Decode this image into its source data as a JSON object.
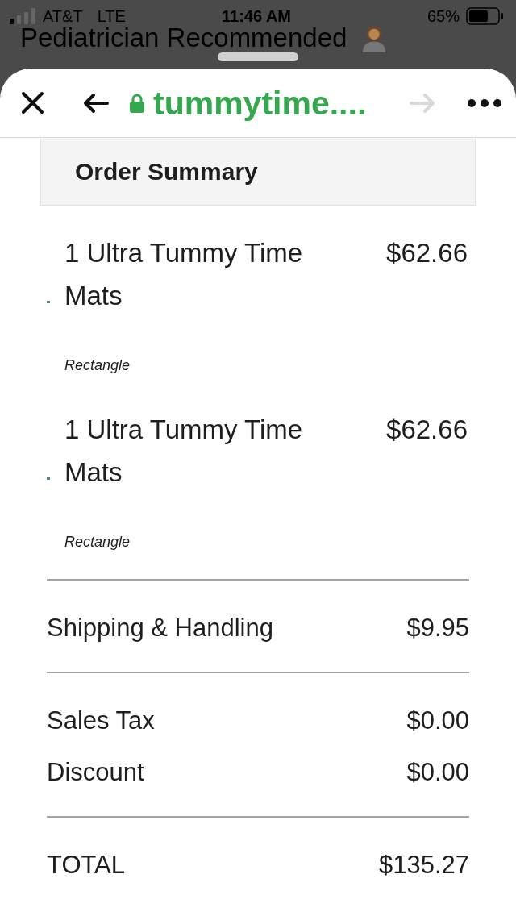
{
  "status_bar": {
    "carrier": "AT&T",
    "network": "LTE",
    "time": "11:46 AM",
    "battery": "65%"
  },
  "background_page": {
    "heading": "Pediatrician Recommended"
  },
  "browser_toolbar": {
    "url": "tummytime....",
    "secure": true,
    "forward_disabled": true
  },
  "order_summary": {
    "title": "Order Summary",
    "items": [
      {
        "name": "1 Ultra Tummy Time Mats",
        "price": "$62.66",
        "variant": "Rectangle"
      },
      {
        "name": "1 Ultra Tummy Time Mats",
        "price": "$62.66",
        "variant": "Rectangle"
      }
    ],
    "charge_groups": [
      {
        "rows": [
          {
            "label": "Shipping & Handling",
            "amount": "$9.95"
          }
        ]
      },
      {
        "rows": [
          {
            "label": "Sales Tax",
            "amount": "$0.00"
          },
          {
            "label": "Discount",
            "amount": "$0.00"
          }
        ]
      }
    ],
    "total": {
      "label": "TOTAL",
      "amount": "$135.27"
    }
  }
}
